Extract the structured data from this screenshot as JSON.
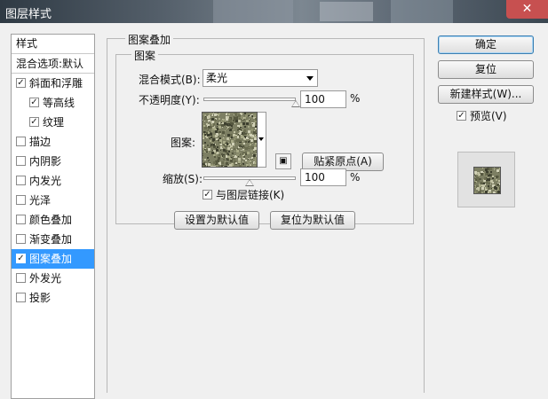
{
  "window": {
    "title": "图层样式",
    "close_symbol": "✕"
  },
  "left_panel": {
    "header": "样式",
    "items": [
      {
        "label": "混合选项:默认",
        "checkbox": false,
        "checked": false,
        "indent": false,
        "selected": false
      },
      {
        "label": "斜面和浮雕",
        "checkbox": true,
        "checked": true,
        "indent": false,
        "selected": false
      },
      {
        "label": "等高线",
        "checkbox": true,
        "checked": true,
        "indent": true,
        "selected": false
      },
      {
        "label": "纹理",
        "checkbox": true,
        "checked": true,
        "indent": true,
        "selected": false
      },
      {
        "label": "描边",
        "checkbox": true,
        "checked": false,
        "indent": false,
        "selected": false
      },
      {
        "label": "内阴影",
        "checkbox": true,
        "checked": false,
        "indent": false,
        "selected": false
      },
      {
        "label": "内发光",
        "checkbox": true,
        "checked": false,
        "indent": false,
        "selected": false
      },
      {
        "label": "光泽",
        "checkbox": true,
        "checked": false,
        "indent": false,
        "selected": false
      },
      {
        "label": "颜色叠加",
        "checkbox": true,
        "checked": false,
        "indent": false,
        "selected": false
      },
      {
        "label": "渐变叠加",
        "checkbox": true,
        "checked": false,
        "indent": false,
        "selected": false
      },
      {
        "label": "图案叠加",
        "checkbox": true,
        "checked": true,
        "indent": false,
        "selected": true
      },
      {
        "label": "外发光",
        "checkbox": true,
        "checked": false,
        "indent": false,
        "selected": false
      },
      {
        "label": "投影",
        "checkbox": true,
        "checked": false,
        "indent": false,
        "selected": false
      }
    ]
  },
  "main": {
    "group_title": "图案叠加",
    "subgroup_title": "图案",
    "blend_mode_label": "混合模式(B):",
    "blend_mode_value": "柔光",
    "opacity_label": "不透明度(Y):",
    "opacity_value": "100",
    "opacity_level": 1.0,
    "opacity_unit": "%",
    "pattern_label": "图案:",
    "snap_origin_button": "贴紧原点(A)",
    "scale_label": "缩放(S):",
    "scale_value": "100",
    "scale_level": 0.5,
    "scale_unit": "%",
    "link_checkbox_label": "与图层链接(K)",
    "link_checked": true,
    "set_default_button": "设置为默认值",
    "reset_default_button": "复位为默认值"
  },
  "right_panel": {
    "ok_button": "确定",
    "reset_button": "复位",
    "new_style_button": "新建样式(W)...",
    "preview_label": "预览(V)",
    "preview_checked": true
  },
  "colors": {
    "selection": "#3399ff",
    "close_button": "#c75050",
    "dialog_bg": "#f0f0f0"
  }
}
